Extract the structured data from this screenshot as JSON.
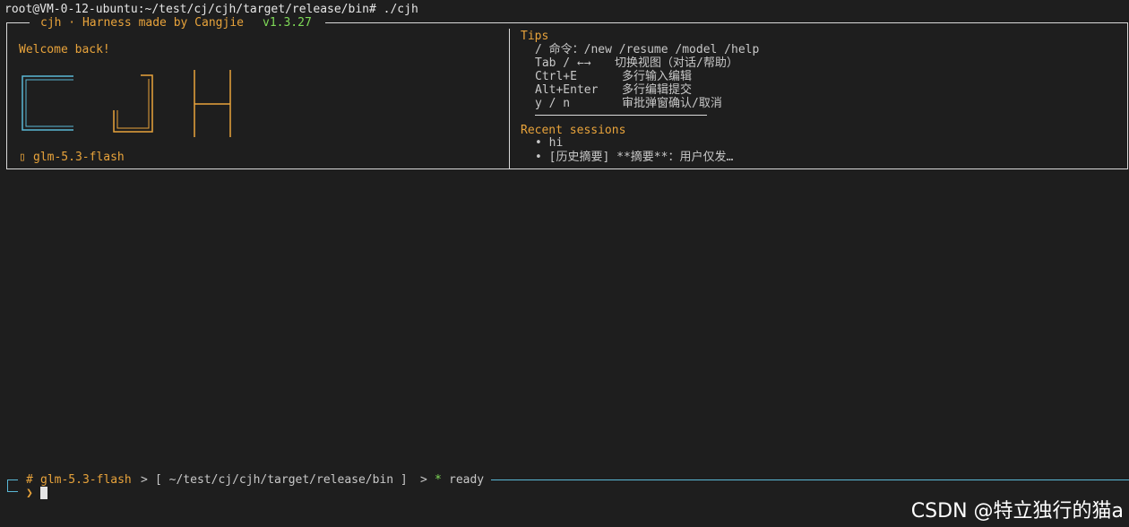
{
  "shell": {
    "command_line": "root@VM-0-12-ubuntu:~/test/cj/cjh/target/release/bin# ./cjh"
  },
  "header": {
    "title": "cjh · Harness made by Cangjie",
    "version": "v1.3.27"
  },
  "welcome": {
    "greeting": "Welcome back!",
    "logo_text": "CJH",
    "model_icon": "model-glyph-icon",
    "model": "glm-5.3-flash"
  },
  "tips": {
    "heading": "Tips",
    "items": [
      {
        "key": "/ 命令：/new /resume /model /help",
        "desc": ""
      },
      {
        "key": "Tab / ←→",
        "desc": "切换视图（对话/帮助）"
      },
      {
        "key": "Ctrl+E",
        "desc": "多行输入编辑"
      },
      {
        "key": "Alt+Enter",
        "desc": "多行编辑提交"
      },
      {
        "key": "y / n",
        "desc": "审批弹窗确认/取消"
      }
    ]
  },
  "recent": {
    "heading": "Recent sessions",
    "sessions": [
      "• hi",
      "• [历史摘要] **摘要**：用户仅发…"
    ]
  },
  "status": {
    "hash": "#",
    "model": "glm-5.3-flash",
    "sep1": ">",
    "path": "[ ~/test/cj/cjh/target/release/bin ]",
    "sep2": ">",
    "star": "*",
    "state": "ready",
    "prompt_symbol": "❯"
  },
  "watermark": "CSDN @特立独行的猫a",
  "colors": {
    "background": "#1e1e1e",
    "accent_orange": "#e8a33b",
    "version_green": "#7ed957",
    "logo_cyan": "#5ab8d6",
    "border": "#d9d9d9"
  }
}
